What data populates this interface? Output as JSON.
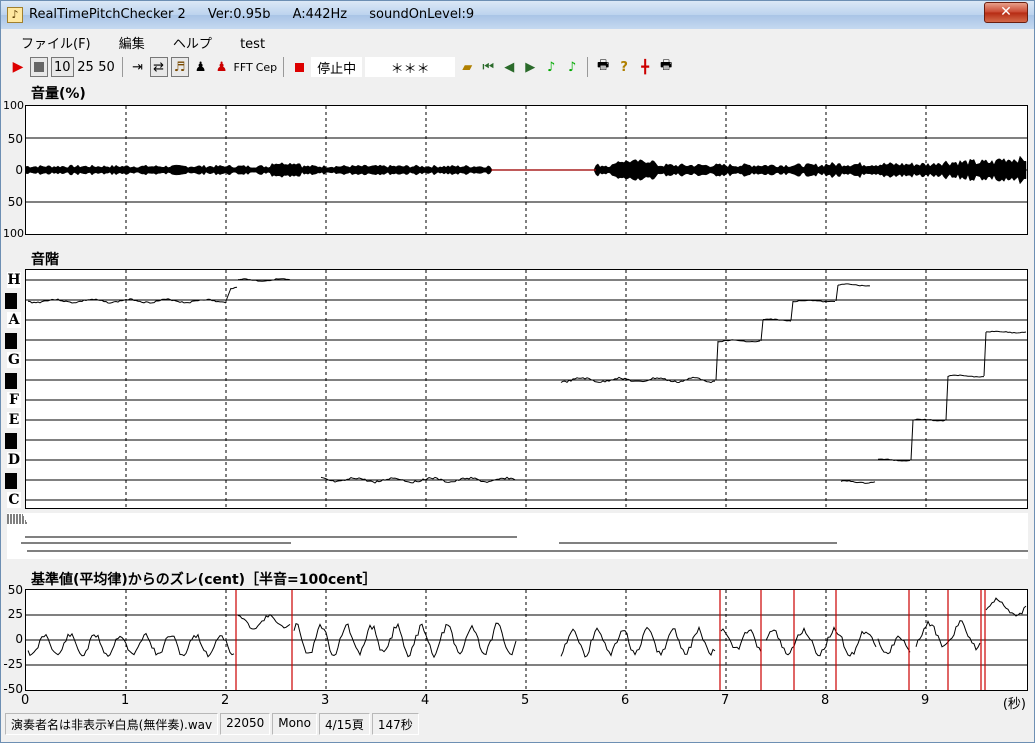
{
  "window": {
    "title": "RealTimePitchChecker 2",
    "version": "Ver:0.95b",
    "a_freq": "A:442Hz",
    "sound_on_level": "soundOnLevel:9",
    "close_label": "✕"
  },
  "menu": {
    "file": "ファイル(F)",
    "edit": "編集",
    "help": "ヘルプ",
    "test": "test"
  },
  "toolbar": {
    "zoom_10": "10",
    "zoom_25": "25",
    "zoom_50": "50",
    "fft": "FFT",
    "cep": "Cep",
    "status": "停止中",
    "note_display": "＊＊＊"
  },
  "volume_panel": {
    "title": "音量(%)",
    "yticks": [
      "100",
      "50",
      "0",
      "50",
      "100"
    ]
  },
  "scale_panel": {
    "title": "音階",
    "notes": [
      "H",
      "A",
      "G",
      "F",
      "E",
      "D",
      "C"
    ]
  },
  "cent_panel": {
    "title": "基準値(平均律)からのズレ(cent)［半音=100cent］",
    "yticks": [
      "50",
      "25",
      "0",
      "-25",
      "-50"
    ]
  },
  "x_axis": {
    "ticks": [
      "0",
      "1",
      "2",
      "3",
      "4",
      "5",
      "6",
      "7",
      "8",
      "9"
    ],
    "unit": "(秒)"
  },
  "statusbar": {
    "file": "演奏者名は非表示¥白鳥(無伴奏).wav",
    "rate": "22050",
    "channel": "Mono",
    "page": "4/15頁",
    "duration": "147秒"
  },
  "colors": {
    "marker": "#cc0000",
    "trace": "#000000"
  }
}
